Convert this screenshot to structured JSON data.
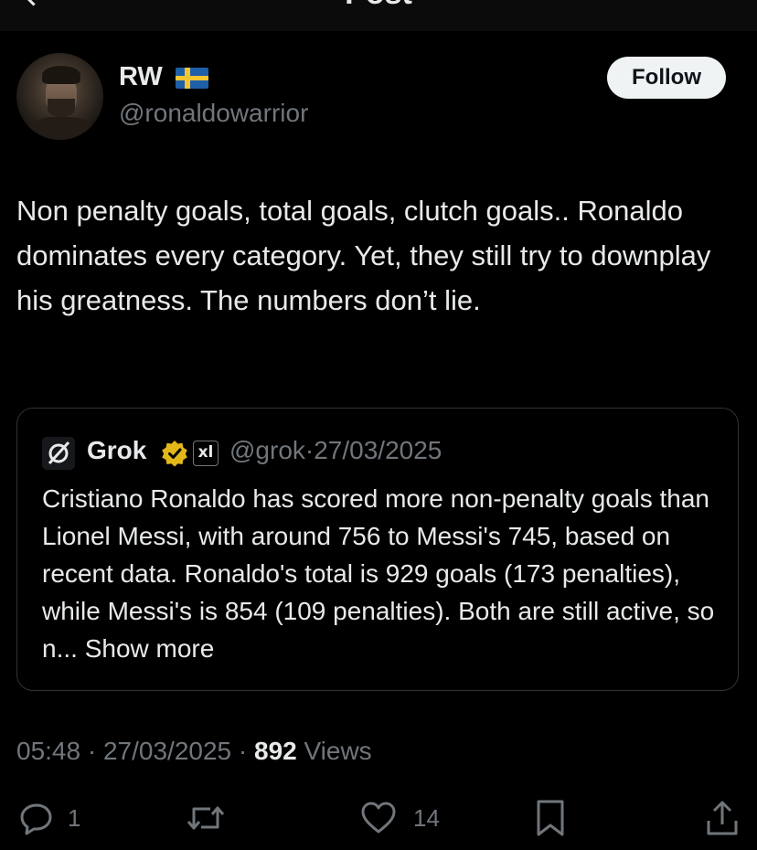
{
  "header": {
    "title": "Post"
  },
  "author": {
    "name": "RW",
    "handle": "@ronaldowarrior",
    "flag": "Sweden flag"
  },
  "follow_button": {
    "label": "Follow"
  },
  "tweet": {
    "text": "Non penalty goals, total goals, clutch goals.. Ronaldo dominates every category. Yet, they still try to downplay his greatness. The numbers don’t lie."
  },
  "quote": {
    "name": "Grok",
    "badge_label": "xl",
    "handle": "@grok",
    "separator": "·",
    "date": "27/03/2025",
    "body": "Cristiano Ronaldo has scored more non-penalty goals than Lionel Messi, with around 756 to Messi's 745, based on recent data. Ronaldo's total is 929 goals (173 penalties), while Messi's is 854 (109 penalties). Both are still active, so n...",
    "show_more": "Show more"
  },
  "meta": {
    "time": "05:48",
    "sep1": "·",
    "date": "27/03/2025",
    "sep2": "·",
    "views_count": "892",
    "views_label": "Views"
  },
  "actions": {
    "reply_count": "1",
    "retweet_count": "",
    "like_count": "14"
  },
  "colors": {
    "background": "#000000",
    "text": "#e7e9ea",
    "muted": "#71767b",
    "border": "#2f3336",
    "verified_gold": "#e2b719"
  }
}
